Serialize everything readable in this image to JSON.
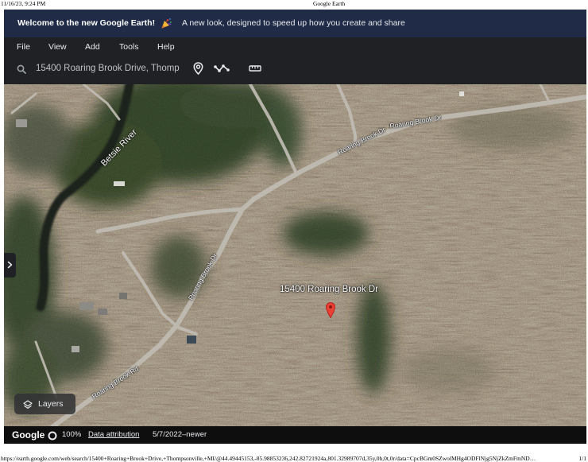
{
  "print_header": {
    "datetime": "11/16/23, 9:24 PM",
    "page_title": "Google Earth"
  },
  "banner": {
    "headline": "Welcome to the new Google Earth!",
    "icon": "party-popper-icon",
    "message": "A new look, designed to speed up how you create and share",
    "background_color": "#1f2b47"
  },
  "menu": {
    "items": [
      "File",
      "View",
      "Add",
      "Tools",
      "Help"
    ]
  },
  "toolbar": {
    "search_icon": "search-icon",
    "search_value": "15400 Roaring Brook Drive, Thomp",
    "tools": [
      "my-location-icon",
      "draw-path-icon",
      "ruler-icon"
    ]
  },
  "map": {
    "view": "satellite",
    "river_label": "Betsie River",
    "road_labels": [
      "Roaring Brook Dr",
      "Roaring Brook Dr",
      "Roaring Brook Dr",
      "Roaring Brook Rd"
    ],
    "placemark": {
      "label": "15400 Roaring Brook Dr",
      "icon": "map-pin-icon",
      "pin_color": "#ea4335"
    },
    "side_panel_toggle": {
      "icon": "chevron-right-icon"
    },
    "layers_button": {
      "label": "Layers",
      "icon": "layers-icon"
    }
  },
  "status_bar": {
    "logo": "Google",
    "loading_icon": "loading-circle-icon",
    "zoom": "100%",
    "attribution_link": "Data attribution",
    "imagery_date": "5/7/2022–newer"
  },
  "print_footer": {
    "url": "https://earth.google.com/web/search/15400+Roaring+Brook+Drive,+Thompsonville,+MI/@44.49445153,-85.98853236,242.82721924a,801.32989707d,35y,0h,0t,0r/data=CpcBGm0SZwolMHg4ODFlNjg5NjZkZmFmND…",
    "page": "1/1"
  }
}
